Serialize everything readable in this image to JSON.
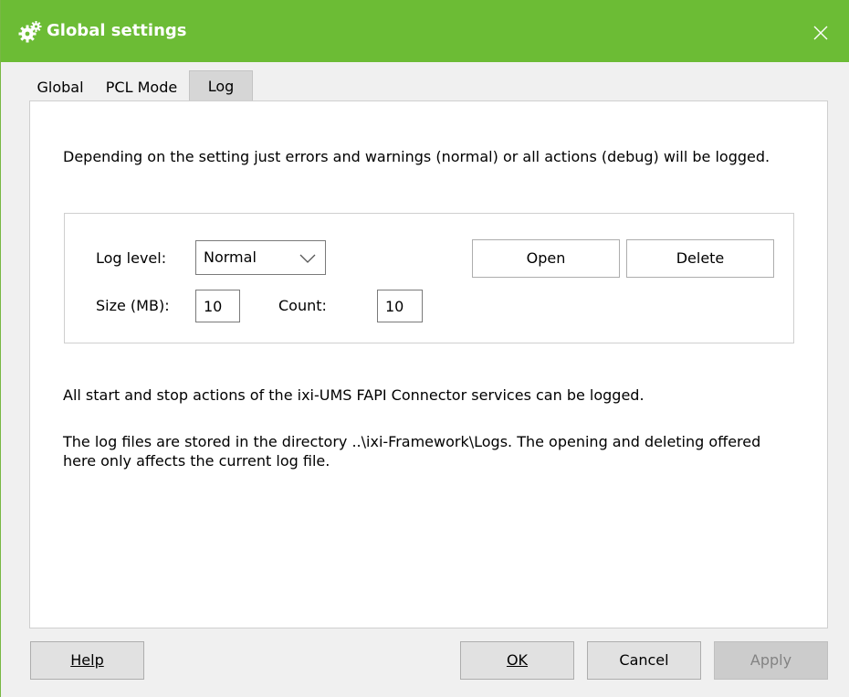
{
  "window": {
    "title": "Global settings",
    "title_icon": "gears-icon",
    "close_icon": "close-icon",
    "colors": {
      "titlebar": "#6cbc35",
      "title_text": "#ffffff"
    }
  },
  "tabs": [
    {
      "label": "Global",
      "selected": false
    },
    {
      "label": "PCL Mode",
      "selected": false
    },
    {
      "label": "Log",
      "selected": true
    }
  ],
  "log_tab": {
    "intro": "Depending on the setting just errors and warnings (normal) or all actions (debug) will be logged.",
    "log_level_label": "Log level:",
    "log_level_value": "Normal",
    "size_label": "Size (MB):",
    "size_value": "10",
    "count_label": "Count:",
    "count_value": "10",
    "open_button": "Open",
    "delete_button": "Delete",
    "info_line1": "All start and stop actions of the ixi-UMS FAPI Connector services can be logged.",
    "info_line2a": "The log files are stored in the directory ..\\ixi-Framework\\Logs. The opening and deleting offered",
    "info_line2b": "here only affects the current log file."
  },
  "footer": {
    "help": "Help",
    "ok": "OK",
    "cancel": "Cancel",
    "apply": "Apply",
    "apply_enabled": false
  }
}
